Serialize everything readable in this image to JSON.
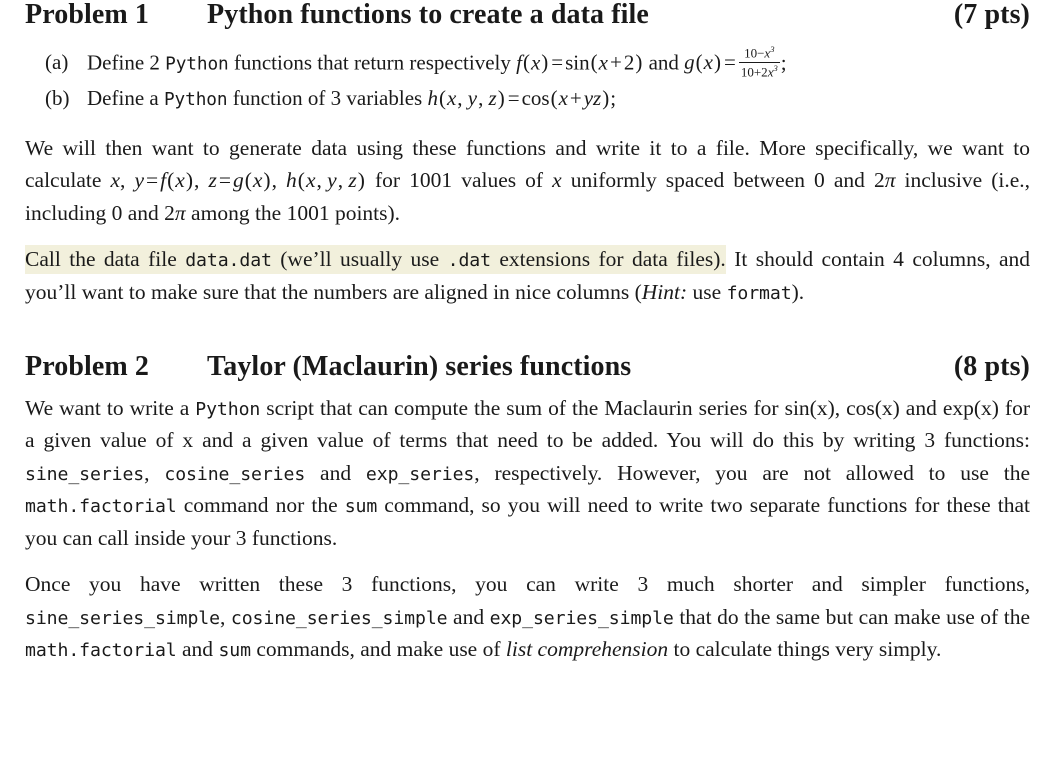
{
  "document": {
    "type": "problem-set",
    "highlight_color": "#f2f0dc",
    "text_color": "#1a1a1a",
    "background_color": "#ffffff"
  },
  "problem1": {
    "label": "Problem 1",
    "title": "Python functions to create a data file",
    "points": "(7 pts)",
    "items": [
      {
        "marker": "(a)",
        "text_parts": {
          "p1": "Define 2 ",
          "code1": "Python",
          "p2": " functions that return respectively ",
          "math_f": "f(x) = sin(x + 2)",
          "p3": " and ",
          "math_g_lhs": "g(x) =",
          "math_g_num": "10 − x³",
          "math_g_den": "10 + 2x³",
          "p4": ";"
        }
      },
      {
        "marker": "(b)",
        "text_parts": {
          "p1": "Define a ",
          "code1": "Python",
          "p2": " function of 3 variables ",
          "math_h": "h(x, y, z) = cos(x + yz)",
          "p3": ";"
        }
      }
    ],
    "paragraph1": "We will then want to generate data using these functions and write it to a file. More specifically, we want to calculate x, y = f(x), z = g(x), h(x, y, z) for 1001 values of x uniformly spaced between 0 and 2π inclusive (i.e., including 0 and 2π among the 1001 points).",
    "paragraph2": {
      "hl1": "Call the data file ",
      "hl_code1": "data.dat",
      "hl2": " (we’ll usually use ",
      "hl_code2": ".dat",
      "hl3": " extensions for data files).",
      "rest1": " It should contain 4 columns, and you’ll want to make sure that the numbers are aligned in nice columns (",
      "hint": "Hint:",
      "rest2": " use ",
      "code_format": "format",
      "rest3": ")."
    }
  },
  "problem2": {
    "label": "Problem 2",
    "title": "Taylor (Maclaurin) series functions",
    "points": "(8 pts)",
    "paragraph1": {
      "t1": "We want to write a ",
      "code1": "Python",
      "t2": " script that can compute the sum of the Maclaurin series for sin(x), cos(x) and exp(x) for a given value of x and a given value of terms that need to be added. You will do this by writing 3 functions: ",
      "code2": "sine_series",
      "t3": ", ",
      "code3": "cosine_series",
      "t4": " and ",
      "code4": "exp_series",
      "t5": ", respectively. However, you are not allowed to use the ",
      "code5": "math.factorial",
      "t6": " command nor the ",
      "code6": "sum",
      "t7": " command, so you will need to write two separate functions for these that you can call inside your 3 functions."
    },
    "paragraph2": {
      "t1": "Once you have written these 3 functions, you can write 3 much shorter and simpler functions, ",
      "code1": "sine_series_simple",
      "t2": ", ",
      "code2": "cosine_series_simple",
      "t3": " and ",
      "code3": "exp_series_simple",
      "t4": " that do the same but can make use of the ",
      "code4": "math.factorial",
      "t5": " and ",
      "code5": "sum",
      "t6": " commands, and make use of ",
      "italic1": "list comprehension",
      "t7": " to calculate things very simply."
    }
  }
}
